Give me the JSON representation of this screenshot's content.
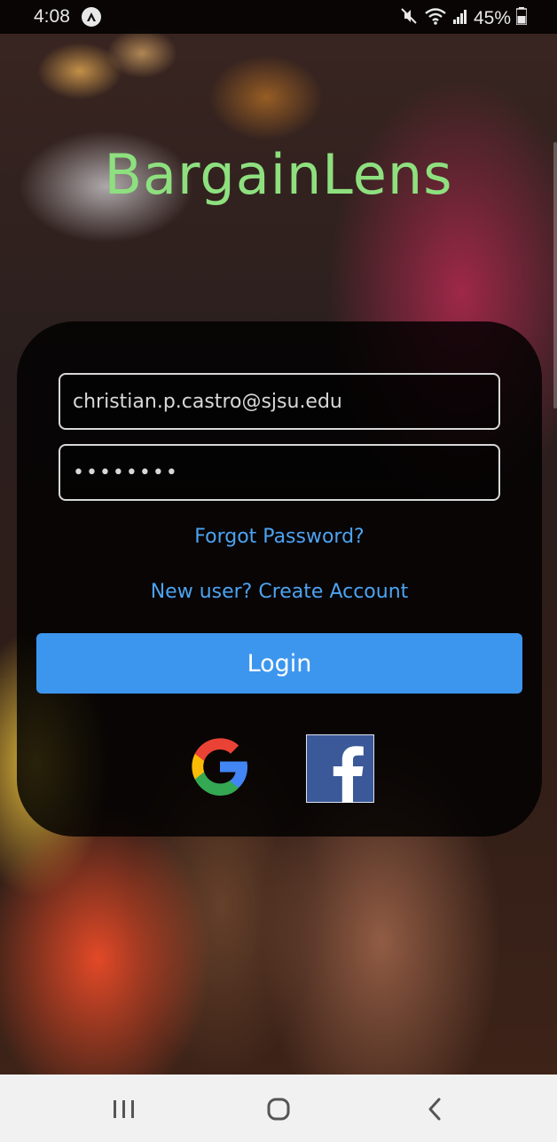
{
  "status_bar": {
    "time": "4:08",
    "battery": "45%",
    "icons": [
      "app-notification-icon",
      "mute-icon",
      "wifi-icon",
      "signal-icon",
      "battery-icon"
    ]
  },
  "app": {
    "title": "BargainLens",
    "title_color": "#8ee07f"
  },
  "login_form": {
    "email_value": "christian.p.castro@sjsu.edu",
    "password_value": "••••••••",
    "forgot_password_label": "Forgot Password?",
    "create_account_label": "New user? Create Account",
    "login_label": "Login",
    "link_color": "#4da3f2",
    "button_color": "#3d96ee"
  },
  "social_login": {
    "google_icon": "google-icon",
    "facebook_icon": "facebook-icon",
    "facebook_color": "#3b5998"
  },
  "nav_bar": {
    "icons": [
      "recent-apps-icon",
      "home-icon",
      "back-icon"
    ]
  }
}
